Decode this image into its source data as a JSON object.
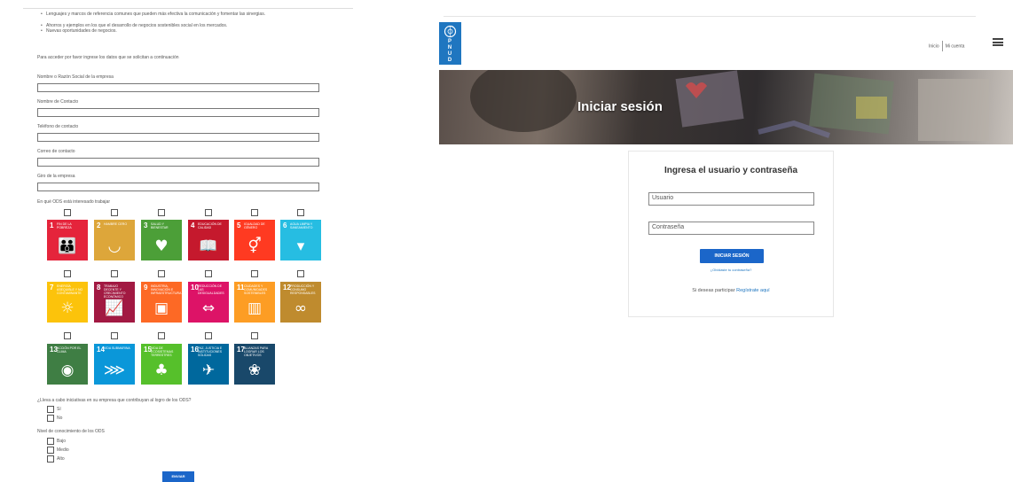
{
  "form": {
    "bullets": [
      "Lenguajes y marcos de referencia comunes que pueden más efectiva la comunicación y fomentar las sinergias.",
      "Ahorros y ejemplos en los que el desarrollo de negocios sostenibles social en los mercados.",
      "Nuevas oportunidades de negocios."
    ],
    "intro": "Para acceder por favor ingrese los datos que se solicitan a continuación",
    "fields": [
      {
        "label": "Nombre o Razón Social de la empresa",
        "value": ""
      },
      {
        "label": "Nombre de Contacto",
        "value": ""
      },
      {
        "label": "Teléfono de contacto",
        "value": ""
      },
      {
        "label": "Correo de contacto",
        "value": ""
      },
      {
        "label": "Giro de la empresa",
        "value": ""
      }
    ],
    "ods_question": "En qué ODS está interesado trabajar",
    "ods": [
      {
        "num": "1",
        "title": "FIN DE LA POBREZA",
        "color": "#e5243b",
        "icon": "family-icon",
        "glyph": "👪"
      },
      {
        "num": "2",
        "title": "HAMBRE CERO",
        "color": "#dda63a",
        "icon": "bowl-icon",
        "glyph": "◡"
      },
      {
        "num": "3",
        "title": "SALUD Y BIENESTAR",
        "color": "#4c9f38",
        "icon": "heartbeat-icon",
        "glyph": "♥"
      },
      {
        "num": "4",
        "title": "EDUCACIÓN DE CALIDAD",
        "color": "#c5192d",
        "icon": "book-icon",
        "glyph": "📖"
      },
      {
        "num": "5",
        "title": "IGUALDAD DE GÉNERO",
        "color": "#ff3a21",
        "icon": "gender-icon",
        "glyph": "⚥"
      },
      {
        "num": "6",
        "title": "AGUA LIMPIA Y SANEAMIENTO",
        "color": "#26bde2",
        "icon": "water-glass-icon",
        "glyph": "▾"
      },
      {
        "num": "7",
        "title": "ENERGÍA ASEQUIBLE Y NO CONTAMINANTE",
        "color": "#fcc30b",
        "icon": "sun-power-icon",
        "glyph": "☼"
      },
      {
        "num": "8",
        "title": "TRABAJO DECENTE Y CRECIMIENTO ECONÓMICO",
        "color": "#a21942",
        "icon": "growth-chart-icon",
        "glyph": "📈"
      },
      {
        "num": "9",
        "title": "INDUSTRIA, INNOVACIÓN E INFRAESTRUCTURA",
        "color": "#fd6925",
        "icon": "cubes-icon",
        "glyph": "▣"
      },
      {
        "num": "10",
        "title": "REDUCCIÓN DE LAS DESIGUALDADES",
        "color": "#dd1367",
        "icon": "equality-icon",
        "glyph": "⇔"
      },
      {
        "num": "11",
        "title": "CIUDADES Y COMUNIDADES SOSTENIBLES",
        "color": "#fd9d24",
        "icon": "city-icon",
        "glyph": "▥"
      },
      {
        "num": "12",
        "title": "PRODUCCIÓN Y CONSUMO RESPONSABLES",
        "color": "#bf8b2e",
        "icon": "infinity-icon",
        "glyph": "∞"
      },
      {
        "num": "13",
        "title": "ACCIÓN POR EL CLIMA",
        "color": "#3f7e44",
        "icon": "eye-globe-icon",
        "glyph": "◉"
      },
      {
        "num": "14",
        "title": "VIDA SUBMARINA",
        "color": "#0a97d9",
        "icon": "fish-icon",
        "glyph": "⋙"
      },
      {
        "num": "15",
        "title": "VIDA DE ECOSISTEMAS TERRESTRES",
        "color": "#56c02b",
        "icon": "tree-icon",
        "glyph": "♣"
      },
      {
        "num": "16",
        "title": "PAZ, JUSTICIA E INSTITUCIONES SÓLIDAS",
        "color": "#00689d",
        "icon": "dove-icon",
        "glyph": "✈"
      },
      {
        "num": "17",
        "title": "ALIANZAS PARA LOGRAR LOS OBJETIVOS",
        "color": "#19486a",
        "icon": "flower-icon",
        "glyph": "❀"
      }
    ],
    "practice_question": "¿Lleva a cabo iniciativas en su empresa que contribuyan al logro de los ODS?",
    "practice_options": [
      "Sí",
      "No"
    ],
    "knowledge_question": "Nivel de conocimiento de los ODS",
    "knowledge_options": [
      "Bajo",
      "Medio",
      "Alto"
    ],
    "submit_label": "ENVIAR"
  },
  "login": {
    "logo_letters": [
      "P",
      "N",
      "U",
      "D"
    ],
    "logo_color": "#1f76c0",
    "nav_home": "Inicio",
    "nav_account": "Mi cuenta",
    "banner_title": "Iniciar sesión",
    "card_title": "Ingresa el usuario y contraseña",
    "username_placeholder": "Usuario",
    "password_placeholder": "Contraseña",
    "login_button": "INICIAR SESIÓN",
    "forgot": "¿Olvidaste tu contraseña?",
    "register_prompt": "Si deseas participar",
    "register_link": "Regístrate aquí",
    "accent_color": "#1b66c9"
  }
}
